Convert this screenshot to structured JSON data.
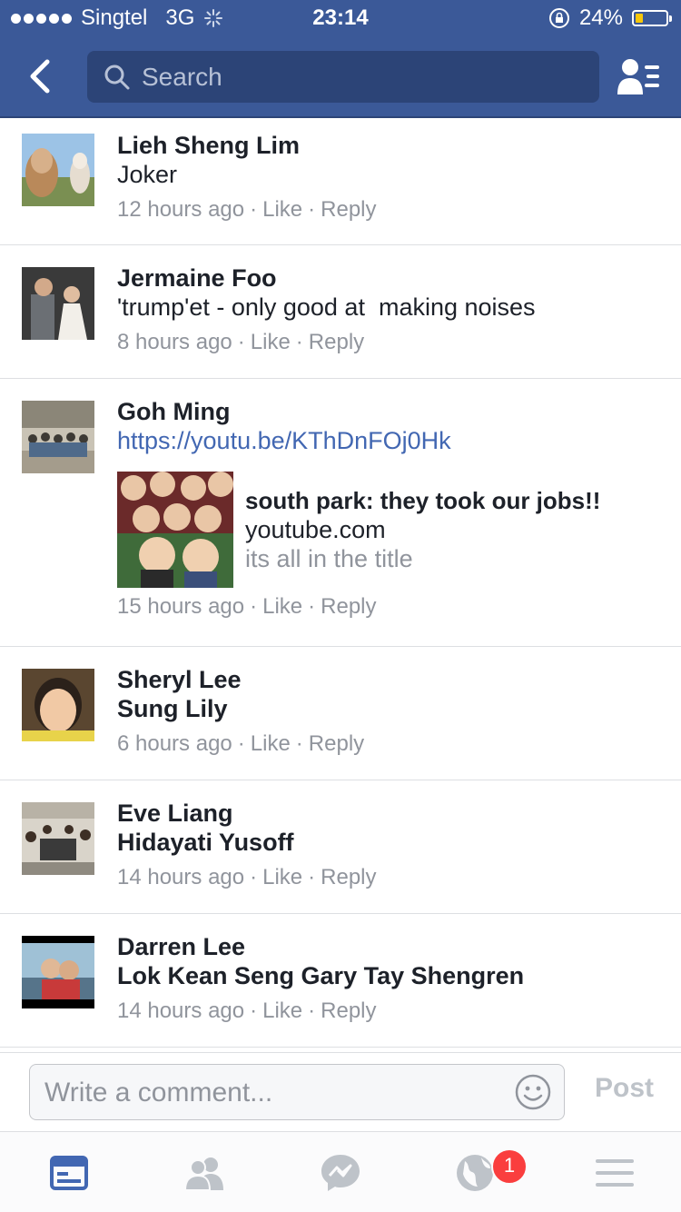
{
  "status_bar": {
    "carrier": "Singtel",
    "network": "3G",
    "time": "23:14",
    "battery": "24%",
    "battery_level": 0.24
  },
  "nav": {
    "search_placeholder": "Search"
  },
  "comments": [
    {
      "name": "Lieh Sheng Lim",
      "text": "Joker",
      "time": "12 hours ago",
      "like": "Like",
      "reply": "Reply"
    },
    {
      "name": "Jermaine Foo",
      "text": "'trump'et - only good at  making noises",
      "time": "8 hours ago",
      "like": "Like",
      "reply": "Reply"
    },
    {
      "name": "Goh Ming",
      "link": "https://youtu.be/KThDnFOj0Hk",
      "preview": {
        "title": "south park: they took our jobs!!",
        "domain": "youtube.com",
        "description": "its all in the title"
      },
      "time": "15 hours ago",
      "like": "Like",
      "reply": "Reply"
    },
    {
      "name": "Sheryl Lee",
      "text": "Sung Lily",
      "time": "6 hours ago",
      "like": "Like",
      "reply": "Reply"
    },
    {
      "name": "Eve Liang",
      "text": "Hidayati Yusoff",
      "time": "14 hours ago",
      "like": "Like",
      "reply": "Reply"
    },
    {
      "name": "Darren Lee",
      "text": "Lok Kean Seng Gary Tay Shengren",
      "time": "14 hours ago",
      "like": "Like",
      "reply": "Reply"
    }
  ],
  "composer": {
    "placeholder": "Write a comment...",
    "post_label": "Post"
  },
  "tabbar": {
    "notifications_badge": "1",
    "active_tab": "news-feed",
    "active_color": "#4267b2",
    "inactive_color": "#bec3c9"
  },
  "colors": {
    "brand": "#3b5998",
    "link": "#4267b2",
    "meta": "#90949c",
    "badge": "#fa3e3e"
  }
}
